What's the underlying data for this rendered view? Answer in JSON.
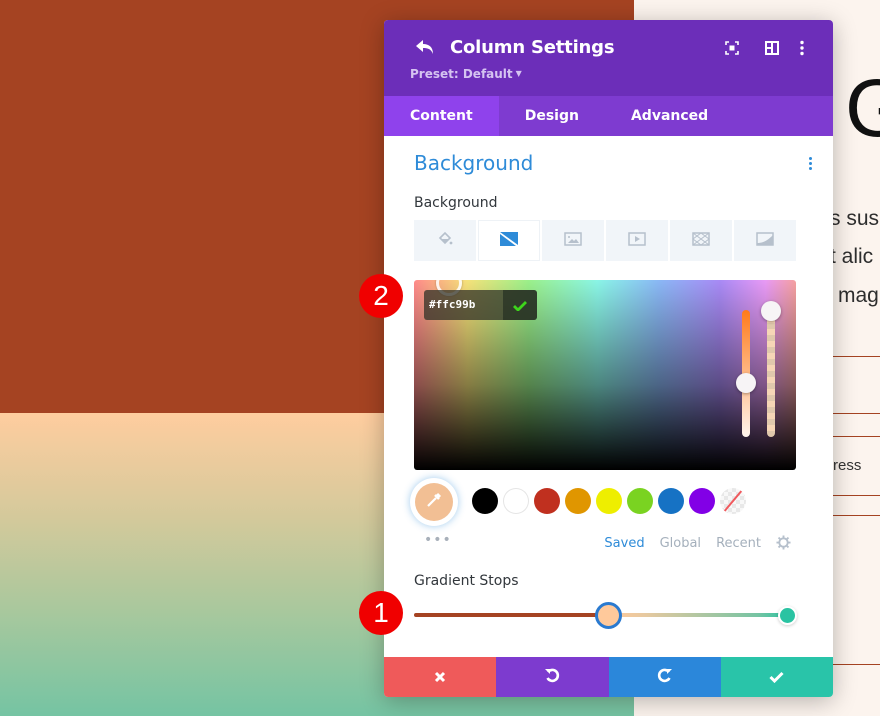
{
  "page": {
    "heading_fragment": "G",
    "text_lines": [
      "s sus",
      "t alic",
      "mag"
    ],
    "small_text": "ress"
  },
  "modal": {
    "title": "Column Settings",
    "preset_label": "Preset: Default",
    "header_icons": [
      "back-icon",
      "focus-mode-icon",
      "split-view-icon",
      "more-options-icon"
    ],
    "tabs": [
      {
        "label": "Content",
        "active": true
      },
      {
        "label": "Design",
        "active": false
      },
      {
        "label": "Advanced",
        "active": false
      }
    ],
    "section_title": "Background",
    "background_field_label": "Background",
    "background_types": [
      {
        "name": "color",
        "icon": "paint-bucket-icon",
        "active": false
      },
      {
        "name": "gradient",
        "icon": "gradient-icon",
        "active": true
      },
      {
        "name": "image",
        "icon": "image-icon",
        "active": false
      },
      {
        "name": "video",
        "icon": "video-icon",
        "active": false
      },
      {
        "name": "pattern",
        "icon": "pattern-icon",
        "active": false
      },
      {
        "name": "mask",
        "icon": "mask-icon",
        "active": false
      }
    ],
    "color_picker": {
      "hex_value": "#ffc99b",
      "current_color": "#f2bf94"
    },
    "swatches": [
      {
        "name": "black",
        "color": "#000000"
      },
      {
        "name": "white",
        "color": "#ffffff"
      },
      {
        "name": "red",
        "color": "#c0301f"
      },
      {
        "name": "orange",
        "color": "#e09600"
      },
      {
        "name": "yellow",
        "color": "#eeee00"
      },
      {
        "name": "green",
        "color": "#7ad321"
      },
      {
        "name": "blue",
        "color": "#1672c4"
      },
      {
        "name": "purple",
        "color": "#8200e6"
      },
      {
        "name": "none",
        "color": "transparent"
      }
    ],
    "more_label": "•••",
    "palette_tabs": [
      {
        "label": "Saved",
        "active": true
      },
      {
        "label": "Global",
        "active": false
      },
      {
        "label": "Recent",
        "active": false
      }
    ],
    "gradient_stops_label": "Gradient Stops",
    "gradient_stops": [
      {
        "color": "#a54322",
        "position_percent": 0
      },
      {
        "color": "#ffc99b",
        "position_percent": 52,
        "selected": true
      },
      {
        "color": "#2ac3a2",
        "position_percent": 100
      }
    ],
    "footer_buttons": [
      {
        "name": "cancel",
        "icon": "close-icon",
        "color": "#ef5a5a"
      },
      {
        "name": "undo",
        "icon": "undo-icon",
        "color": "#7d3bcf"
      },
      {
        "name": "redo",
        "icon": "redo-icon",
        "color": "#2b87da"
      },
      {
        "name": "save",
        "icon": "check-icon",
        "color": "#29c4a9"
      }
    ]
  },
  "markers": [
    "1",
    "2"
  ]
}
